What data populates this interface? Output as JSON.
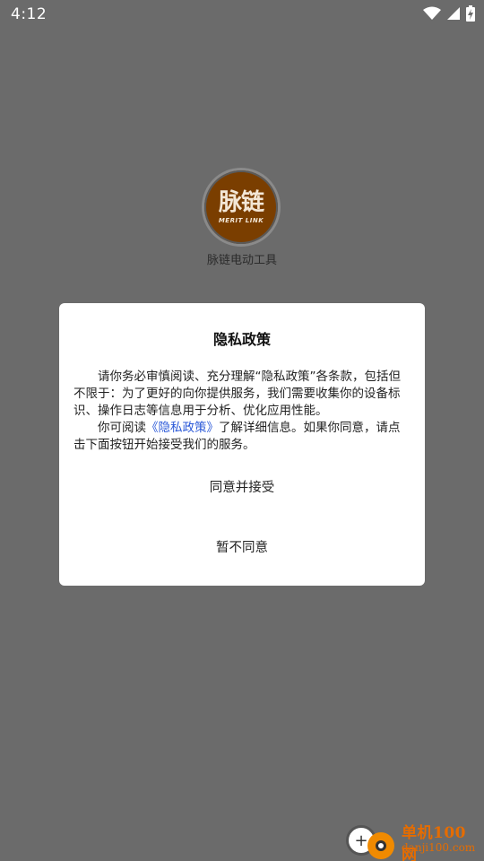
{
  "status_bar": {
    "time": "4:12",
    "icons": [
      "wifi-icon",
      "cell-signal-icon",
      "battery-charging-icon"
    ]
  },
  "splash": {
    "logo_cn": "脉链",
    "logo_en": "MERIT LINK",
    "app_name": "脉链电动工具"
  },
  "dialog": {
    "title": "隐私政策",
    "paragraph1": "请你务必审慎阅读、充分理解“隐私政策”各条款，包括但不限于：为了更好的向你提供服务，我们需要收集你的设备标识、操作日志等信息用于分析、优化应用性能。",
    "paragraph2_prefix": "你可阅读",
    "paragraph2_link": "《隐私政策》",
    "paragraph2_suffix": "了解详细信息。如果你同意，请点击下面按钮开始接受我们的服务。",
    "agree_label": "同意并接受",
    "decline_label": "暂不同意"
  },
  "watermark": {
    "cn": "单机100网",
    "en": "danji100.com"
  },
  "colors": {
    "overlay": "#6b6b6b",
    "link": "#2b59d8",
    "logo_bg": "#7a3e00",
    "watermark": "#e56c00"
  }
}
